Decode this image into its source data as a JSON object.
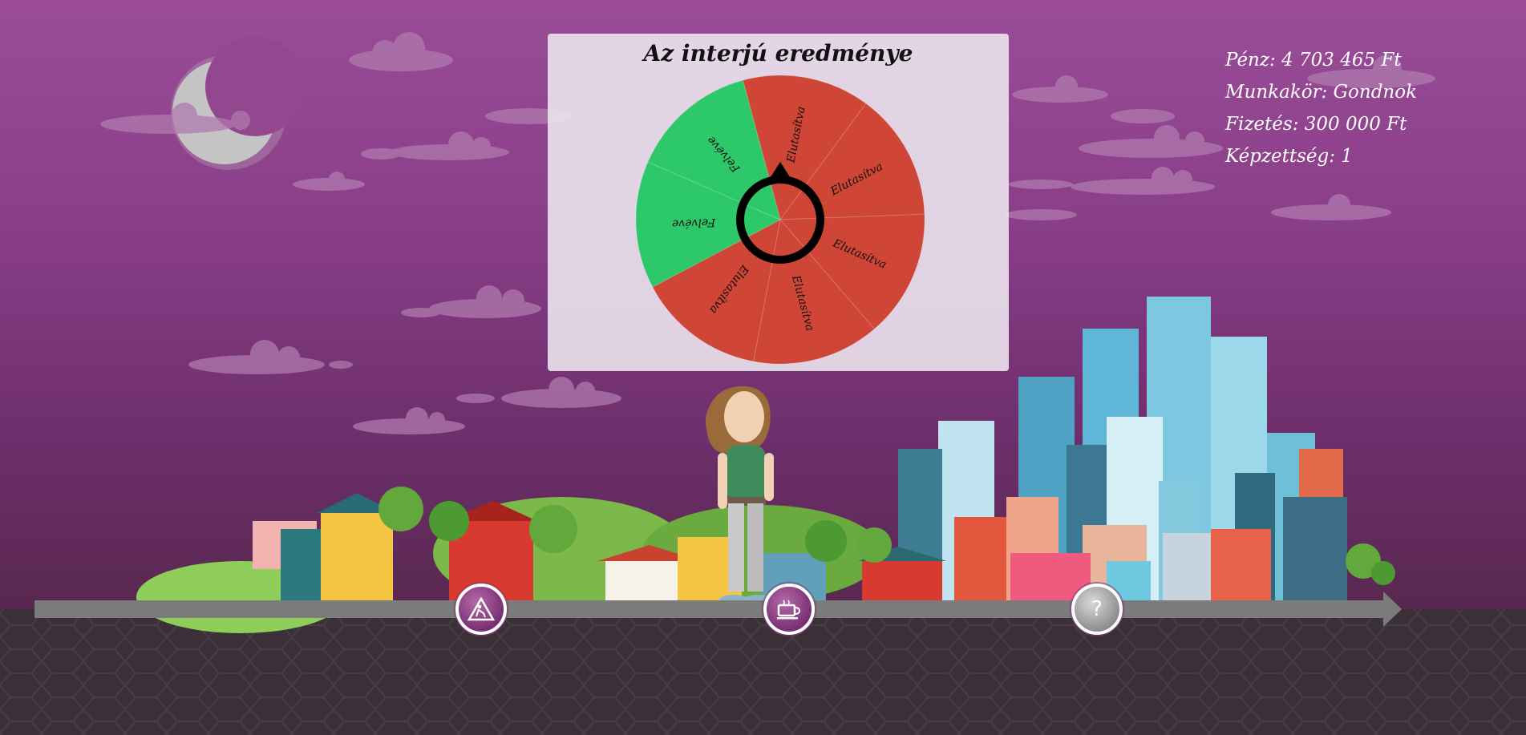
{
  "hud": {
    "money": "Pénz: 4 703 465 Ft",
    "job": "Munkakör: Gondnok",
    "salary": "Fizetés: 300 000 Ft",
    "education": "Képzettség: 1"
  },
  "interview": {
    "title": "Az interjú eredménye",
    "segments": [
      {
        "label": "Elutasítva",
        "result": "rejected"
      },
      {
        "label": "Elutasítva",
        "result": "rejected"
      },
      {
        "label": "Elutasítva",
        "result": "rejected"
      },
      {
        "label": "Elutasítva",
        "result": "rejected"
      },
      {
        "label": "Elutasítva",
        "result": "rejected"
      },
      {
        "label": "Felvéve",
        "result": "hired"
      },
      {
        "label": "Felvéve",
        "result": "hired"
      }
    ],
    "colors": {
      "rejected": "#cf4536",
      "hired": "#2dc86a"
    }
  },
  "timeline": {
    "markers": [
      {
        "icon": "road-work-icon"
      },
      {
        "icon": "coffee-cup-icon"
      },
      {
        "icon": "question-mark-icon",
        "glyph": "?"
      }
    ]
  }
}
